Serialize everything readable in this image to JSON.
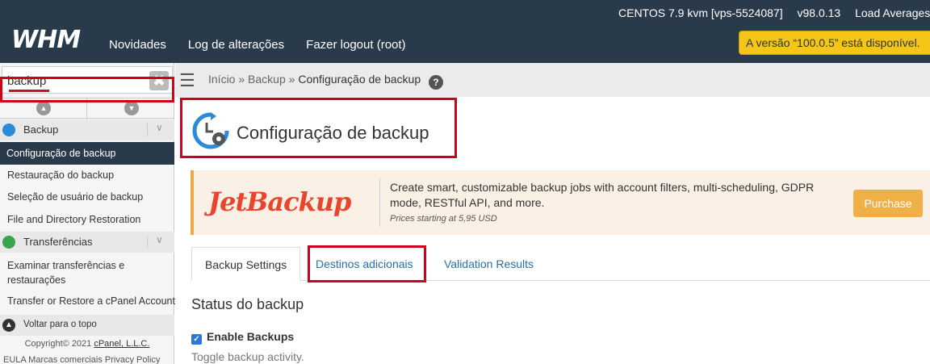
{
  "header": {
    "logo": "WHM",
    "nav": [
      "Novidades",
      "Log de alterações",
      "Fazer logout (root)"
    ],
    "os": "CENTOS 7.9 kvm [vps-5524087]",
    "version": "v98.0.13",
    "load_label": "Load Averages:",
    "update_notice": "A versão “100.0.5” está disponível."
  },
  "sidebar": {
    "search_value": "backup",
    "clear_glyph": "✖",
    "scroll_up": "▲",
    "scroll_down": "▼",
    "categories": [
      {
        "label": "Backup",
        "color": "#2b8ad9"
      },
      {
        "label": "Transferências",
        "color": "#3aa44a"
      }
    ],
    "backup_items": [
      "Configuração de backup",
      "Restauração do backup",
      "Seleção de usuário de backup",
      "File and Directory Restoration"
    ],
    "transfer_items": [
      "Examinar transferências e",
      "restaurações",
      "Transfer or Restore a cPanel Account"
    ],
    "chevron": "∨",
    "back_to_top": "Voltar para o topo",
    "copyright_prefix": "Copyright© 2021 ",
    "copyright_company": "cPanel, L.L.C.",
    "footer_links": "EULA   Marcas comerciais   Privacy Policy"
  },
  "breadcrumb": {
    "home": "Início",
    "section": "Backup",
    "current": "Configuração de backup",
    "separator": "»",
    "help": "?"
  },
  "page": {
    "title": "Configuração de backup"
  },
  "promo": {
    "brand": "JetBackup",
    "description": "Create smart, customizable backup jobs with account filters, multi-scheduling, GDPR mode, RESTful API, and more.",
    "price": "Prices starting at 5,95 USD",
    "button": "Purchase"
  },
  "tabs": [
    "Backup Settings",
    "Destinos adicionais",
    "Validation Results"
  ],
  "status": {
    "title": "Status do backup",
    "checkbox_label": "Enable Backups",
    "checked": true,
    "help": "Toggle backup activity."
  },
  "colors": {
    "header_bg": "#293a4a",
    "highlight": "#d0021b",
    "link": "#2a6fa8",
    "accent": "#f0b048"
  }
}
